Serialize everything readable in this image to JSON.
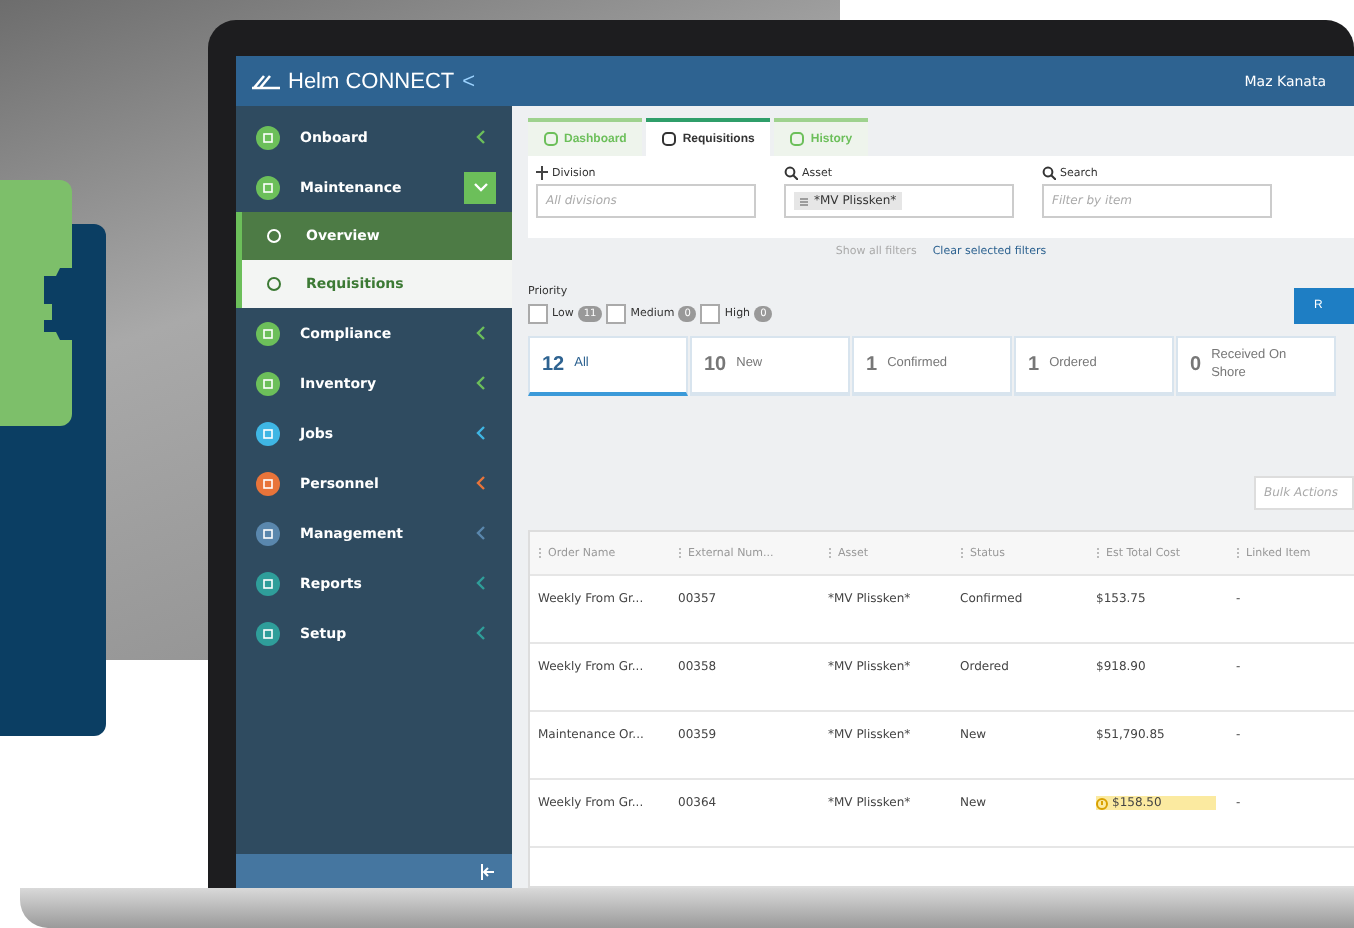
{
  "header": {
    "logo": "Helm CONNECT",
    "collapse": "<",
    "user": "Maz Kanata"
  },
  "sidebar": {
    "items": [
      {
        "label": "Onboard",
        "color": "#6cbf5a",
        "selected": false,
        "expanded": false
      },
      {
        "label": "Maintenance",
        "color": "#6cbf5a",
        "selected": false,
        "expanded": true,
        "children": [
          {
            "label": "Overview",
            "selected": false
          },
          {
            "label": "Requisitions",
            "selected": true
          }
        ]
      },
      {
        "label": "Compliance",
        "color": "#6cbf5a",
        "selected": false,
        "expanded": false
      },
      {
        "label": "Inventory",
        "color": "#6cbf5a",
        "selected": false,
        "expanded": false
      },
      {
        "label": "Jobs",
        "color": "#3fb6e4",
        "selected": false,
        "expanded": false
      },
      {
        "label": "Personnel",
        "color": "#e8743a",
        "selected": false,
        "expanded": false
      },
      {
        "label": "Management",
        "color": "#5a87ad",
        "selected": false,
        "expanded": false
      },
      {
        "label": "Reports",
        "color": "#2f9e9a",
        "selected": false,
        "expanded": false
      },
      {
        "label": "Setup",
        "color": "#2f9e9a",
        "selected": false,
        "expanded": false
      }
    ]
  },
  "tabs": [
    {
      "label": "Dashboard",
      "selected": false
    },
    {
      "label": "Requisitions",
      "selected": true
    },
    {
      "label": "History",
      "selected": false
    }
  ],
  "filters": {
    "division": {
      "label": "Division",
      "placeholder": "All divisions"
    },
    "asset": {
      "label": "Asset",
      "tag": "*MV Plissken*"
    },
    "search": {
      "label": "Search",
      "placeholder": "Filter by item"
    },
    "show_all": "Show all filters",
    "clear": "Clear selected filters"
  },
  "priority": {
    "label": "Priority",
    "options": [
      {
        "label": "Low",
        "count": "11",
        "checked": false
      },
      {
        "label": "Medium",
        "count": "0",
        "checked": false
      },
      {
        "label": "High",
        "count": "0",
        "checked": false
      }
    ]
  },
  "action_button": "R",
  "status_cards": [
    {
      "count": "12",
      "label": "All",
      "selected": true
    },
    {
      "count": "10",
      "label": "New",
      "selected": false
    },
    {
      "count": "1",
      "label": "Confirmed",
      "selected": false
    },
    {
      "count": "1",
      "label": "Ordered",
      "selected": false
    },
    {
      "count": "0",
      "label": "Received On Shore",
      "selected": false
    }
  ],
  "bulk_actions": {
    "placeholder": "Bulk Actions"
  },
  "table": {
    "columns": [
      "Order Name",
      "External Num...",
      "Asset",
      "Status",
      "Est Total Cost",
      "Linked Item"
    ],
    "rows": [
      {
        "cells": [
          "Weekly From Gr...",
          "00357",
          "*MV Plissken*",
          "Confirmed",
          "$153.75",
          "-"
        ],
        "flagged": false
      },
      {
        "cells": [
          "Weekly From Gr...",
          "00358",
          "*MV Plissken*",
          "Ordered",
          "$918.90",
          "-"
        ],
        "flagged": false
      },
      {
        "cells": [
          "Maintenance Or...",
          "00359",
          "*MV Plissken*",
          "New",
          "$51,790.85",
          "-"
        ],
        "flagged": false
      },
      {
        "cells": [
          "Weekly From Gr...",
          "00364",
          "*MV Plissken*",
          "New",
          "$158.50",
          "-"
        ],
        "flagged": true
      }
    ]
  }
}
